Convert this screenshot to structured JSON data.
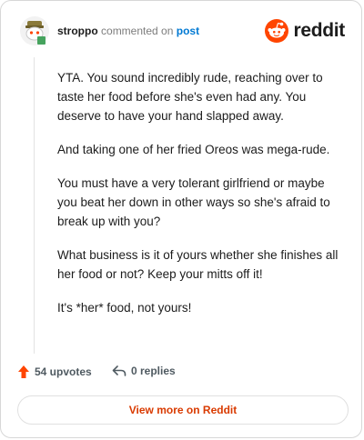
{
  "header": {
    "username": "stroppo",
    "action": "commented on",
    "target_link": "post",
    "brand": "reddit"
  },
  "comment": {
    "paragraphs": [
      "YTA. You sound incredibly rude, reaching over to taste her food before she's even had any. You deserve to have your hand slapped away.",
      "And taking one of her fried Oreos was mega-rude.",
      "You must have a very tolerant girlfriend or maybe you beat her down in other ways so she's afraid to break up with you?",
      "What business is it of yours whether she finishes all her food or not? Keep your mitts off it!",
      "It's *her* food, not yours!"
    ]
  },
  "footer": {
    "upvotes": "54 upvotes",
    "replies": "0 replies",
    "view_button": "View more on Reddit"
  },
  "colors": {
    "brand_orange": "#ff4500",
    "link_blue": "#0079d3",
    "button_text": "#d93a00"
  },
  "icons": {
    "avatar": "snoo-avatar-icon",
    "brand": "reddit-logo-icon",
    "upvote": "upvote-arrow-icon",
    "reply": "reply-arrow-icon"
  }
}
